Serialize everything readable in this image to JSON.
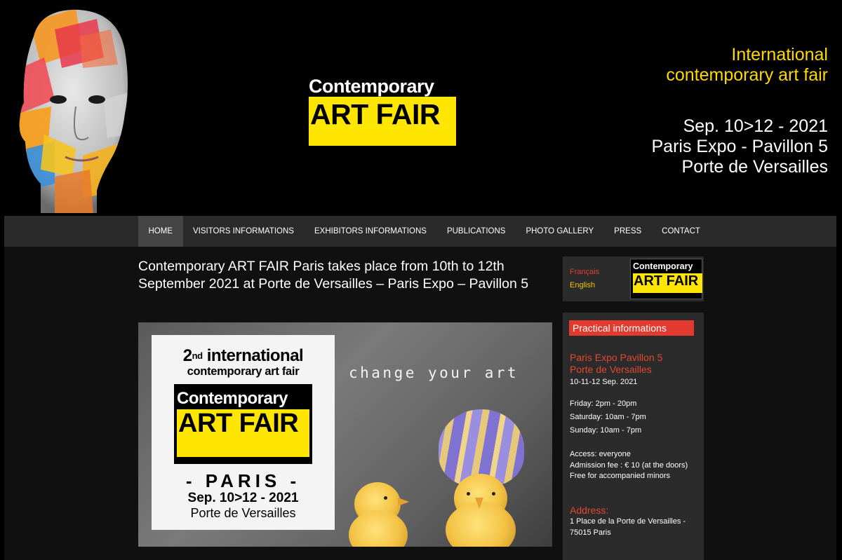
{
  "header": {
    "logo": {
      "line1": "Contemporary",
      "line2": "ART FAIR"
    },
    "tagline": [
      "International",
      "contemporary art fair"
    ],
    "event": [
      "Sep. 10>12 - 2021",
      "Paris Expo - Pavillon 5",
      "Porte de Versailles"
    ]
  },
  "nav": {
    "items": [
      {
        "label": "HOME"
      },
      {
        "label": "VISITORS INFORMATIONS"
      },
      {
        "label": "EXHIBITORS INFORMATIONS"
      },
      {
        "label": "PUBLICATIONS"
      },
      {
        "label": "PHOTO GALLERY"
      },
      {
        "label": "PRESS"
      },
      {
        "label": "CONTACT"
      }
    ],
    "active_index": 0
  },
  "main": {
    "headline": "Contemporary ART FAIR Paris takes place from 10th to 12th September 2021 at Porte de Versailles – Paris Expo – Pavillon 5",
    "banner": {
      "edition_num": "2",
      "edition_suffix": "nd",
      "edition_word": "international",
      "subtitle": "contemporary art fair",
      "logo_line1": "Contemporary",
      "logo_line2": "ART FAIR",
      "city": "- PARIS -",
      "dates": "Sep. 10>12 - 2021",
      "venue": "Porte de Versailles",
      "slogan": "change your art"
    }
  },
  "sidebar": {
    "languages": [
      "Français",
      "English"
    ],
    "mini_logo": {
      "line1": "Contemporary",
      "line2": "ART FAIR"
    },
    "practical": {
      "title": "Practical informations",
      "venue": [
        "Paris Expo Pavillon 5",
        "Porte de Versailles"
      ],
      "dates": "10-11-12 Sep. 2021",
      "hours": [
        "Friday: 2pm - 20pm",
        "Saturday: 10am - 7pm",
        "Sunday: 10am - 7pm"
      ],
      "access": [
        "Access: everyone",
        "Admission fee : € 10 (at the doors)",
        "Free for accompanied minors"
      ],
      "address_heading": "Address:",
      "address": [
        "1 Place de la Porte de Versailles -",
        "75015 Paris"
      ]
    }
  },
  "colors": {
    "accent_yellow": "#ffe600",
    "tagline_yellow": "#ffd800",
    "accent_red": "#e23a2e",
    "nav_bg": "#2a2a2a",
    "panel_bg": "#2b2b2b"
  }
}
